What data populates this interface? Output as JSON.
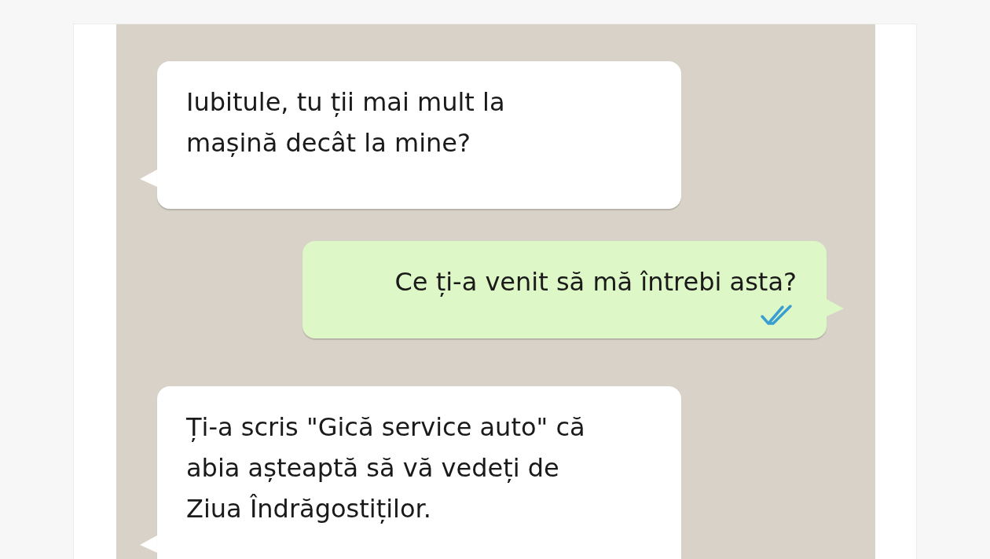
{
  "messages": [
    {
      "kind": "incoming",
      "text": "Iubitule, tu ții mai mult la\nmașină decât la mine?"
    },
    {
      "kind": "outgoing",
      "text": "Ce ți-a venit să mă întrebi asta?",
      "read": true
    },
    {
      "kind": "incoming",
      "text": "Ți-a scris \"Gică service auto\" că\nabia așteaptă să vă vedeți de\nZiua Îndrăgostiților."
    }
  ]
}
